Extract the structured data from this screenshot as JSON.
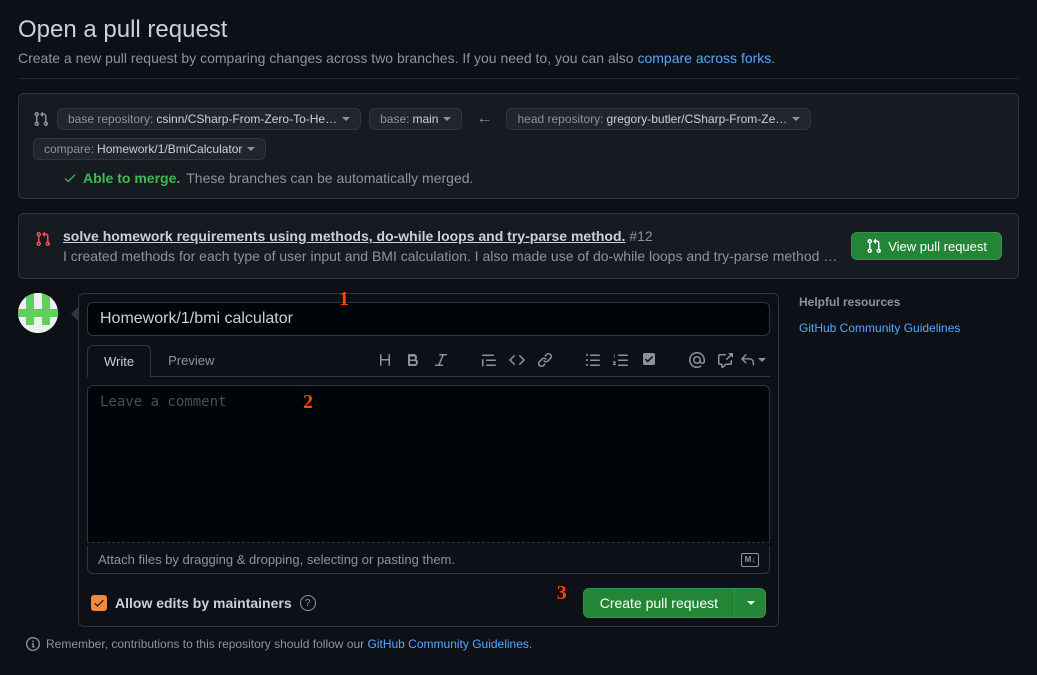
{
  "header": {
    "title": "Open a pull request",
    "subtitle_pre": "Create a new pull request by comparing changes across two branches. If you need to, you can also ",
    "compare_link": "compare across forks",
    "subtitle_post": "."
  },
  "compare": {
    "base_repo_label": "base repository: ",
    "base_repo_value": "csinn/CSharp-From-Zero-To-He…",
    "base_label": "base: ",
    "base_value": "main",
    "head_repo_label": "head repository: ",
    "head_repo_value": "gregory-butler/CSharp-From-Ze…",
    "compare_label": "compare: ",
    "compare_value": "Homework/1/BmiCalculator",
    "merge_able": "Able to merge.",
    "merge_text": "These branches can be automatically merged."
  },
  "existing_pr": {
    "title": "solve homework requirements using methods, do-while loops and try-parse method.",
    "number": "#12",
    "desc": "I created methods for each type of user input and BMI calculation. I also made use of do-while loops and try-parse method to not let the user co…",
    "view_btn": "View pull request"
  },
  "form": {
    "title_value": "Homework/1/bmi calculator",
    "tabs": {
      "write": "Write",
      "preview": "Preview"
    },
    "comment_placeholder": "Leave a comment",
    "attach_hint": "Attach files by dragging & dropping, selecting or pasting them.",
    "allow_edits": "Allow edits by maintainers",
    "create_btn": "Create pull request",
    "note_pre": "Remember, contributions to this repository should follow our ",
    "note_link": "GitHub Community Guidelines",
    "note_post": "."
  },
  "sidebar": {
    "title": "Helpful resources",
    "link": "GitHub Community Guidelines"
  },
  "annotations": {
    "a1": "1",
    "a2": "2",
    "a3": "3"
  }
}
